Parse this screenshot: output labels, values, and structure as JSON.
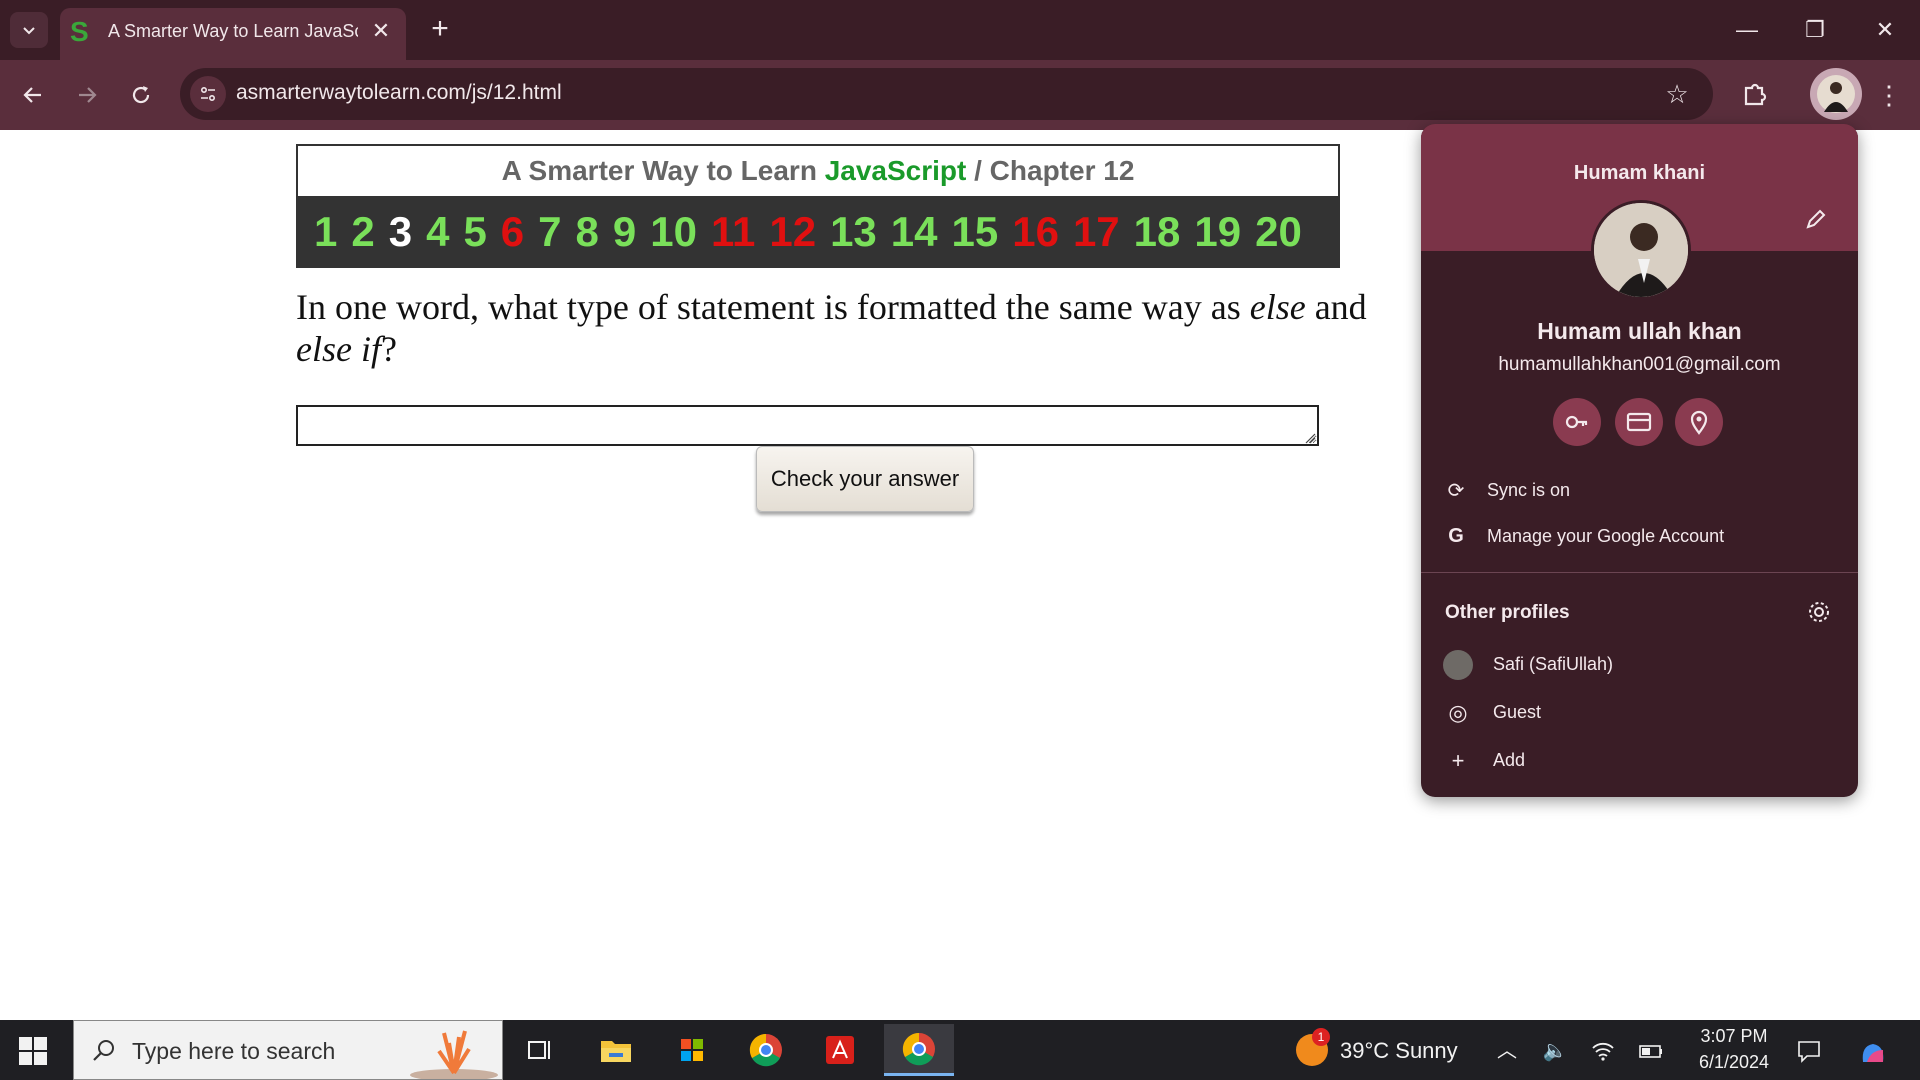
{
  "browser": {
    "tab_title": "A Smarter Way to Learn JavaScr",
    "tab_favicon": "S",
    "new_tab_label": "+",
    "url": "asmarterwaytolearn.com/js/12.html"
  },
  "page": {
    "header_prefix": "A Smarter Way to Learn ",
    "header_js": "JavaScript",
    "header_suffix": "  /  Chapter 12",
    "chapters": [
      {
        "num": "1",
        "state": "green"
      },
      {
        "num": "2",
        "state": "green"
      },
      {
        "num": "3",
        "state": "white"
      },
      {
        "num": "4",
        "state": "green"
      },
      {
        "num": "5",
        "state": "green"
      },
      {
        "num": "6",
        "state": "red"
      },
      {
        "num": "7",
        "state": "green"
      },
      {
        "num": "8",
        "state": "green"
      },
      {
        "num": "9",
        "state": "green"
      },
      {
        "num": "10",
        "state": "green"
      },
      {
        "num": "11",
        "state": "red"
      },
      {
        "num": "12",
        "state": "red"
      },
      {
        "num": "13",
        "state": "green"
      },
      {
        "num": "14",
        "state": "green"
      },
      {
        "num": "15",
        "state": "green"
      },
      {
        "num": "16",
        "state": "red"
      },
      {
        "num": "17",
        "state": "red"
      },
      {
        "num": "18",
        "state": "green"
      },
      {
        "num": "19",
        "state": "green"
      },
      {
        "num": "20",
        "state": "green"
      }
    ],
    "question_part1": "In one word, what type of statement is formatted the same way as ",
    "question_em1": "else",
    "question_part2": " and ",
    "question_em2": "else if",
    "question_part3": "?",
    "answer_value": "",
    "check_button": "Check your answer"
  },
  "profile_popup": {
    "profile_name": "Humam khani",
    "full_name": "Humam ullah khan",
    "email": "humamullahkhan001@gmail.com",
    "sync_label": "Sync is on",
    "manage_label": "Manage your Google Account",
    "other_profiles_title": "Other profiles",
    "profiles": [
      {
        "name": "Safi (SafiUllah)",
        "icon": "avatar-icon"
      },
      {
        "name": "Guest",
        "icon": "guest-icon"
      },
      {
        "name": "Add",
        "icon": "add-icon"
      }
    ]
  },
  "taskbar": {
    "search_placeholder": "Type here to search",
    "weather": "39°C  Sunny",
    "weather_badge": "1",
    "time": "3:07 PM",
    "date": "6/1/2024"
  },
  "colors": {
    "chrome_dark": "#3a1d26",
    "chrome_mid": "#5a2e3c",
    "chapter_green": "#7ae05a",
    "chapter_red": "#e01010",
    "js_green": "#1a9a2a"
  }
}
